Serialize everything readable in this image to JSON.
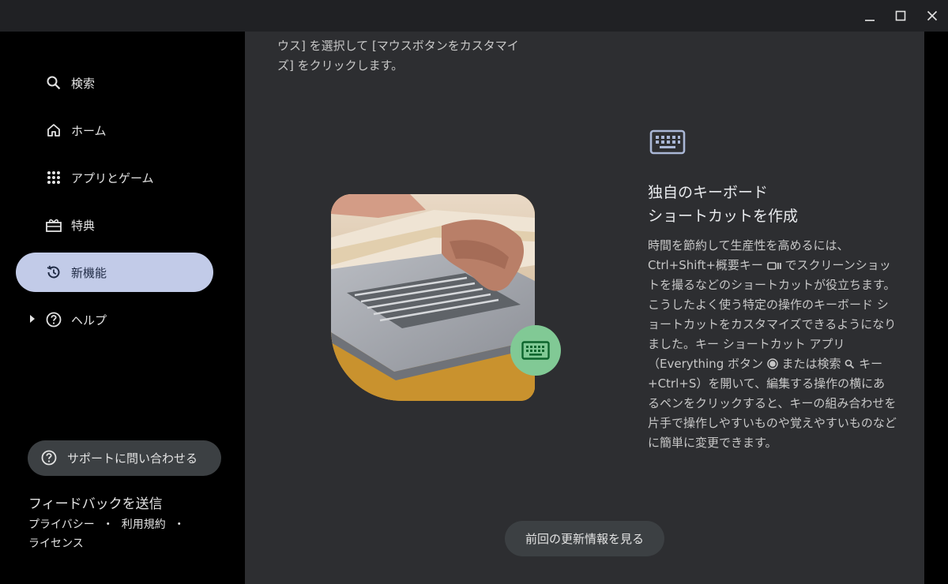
{
  "window": {
    "controls": {
      "minimize": "minimize-icon",
      "maximize": "maximize-icon",
      "close": "close-icon"
    }
  },
  "sidebar": {
    "items": [
      {
        "label": "検索",
        "icon": "search-icon"
      },
      {
        "label": "ホーム",
        "icon": "home-icon"
      },
      {
        "label": "アプリとゲーム",
        "icon": "apps-grid-icon"
      },
      {
        "label": "特典",
        "icon": "gift-icon"
      },
      {
        "label": "新機能",
        "icon": "history-icon",
        "active": true
      },
      {
        "label": "ヘルプ",
        "icon": "help-icon",
        "expandable": true
      }
    ],
    "support_label": "サポートに問い合わせる",
    "feedback_label": "フィードバックを送信",
    "legal": {
      "privacy": "プライバシー",
      "terms": "利用規約",
      "separator": "・",
      "license": "ライセンス"
    }
  },
  "main": {
    "top_text": "ウス] を選択して [マウスボタンをカスタマイズ] をクリックします。",
    "feature": {
      "icon": "keyboard-icon",
      "title_line1": "独自のキーボード",
      "title_line2": "ショートカットを作成",
      "body_part1": "時間を節約して生産性を高めるには、Ctrl+Shift+概要キー",
      "body_part2": "でスクリーンショットを撮るなどのショートカットが役立ちます。こうしたよく使う特定の操作のキーボード ショートカットをカスタマイズできるようになりました。キー ショートカット アプリ（Everything ボタン",
      "body_part3": "または検索",
      "body_part4": "キー+Ctrl+S）を開いて、編集する操作の横にあるペンをクリックすると、キーの組み合わせを片手で操作しやすいものや覚えやすいものなどに簡単に変更できます。"
    },
    "prev_button": "前回の更新情報を見る"
  },
  "colors": {
    "active_nav": "#c2cbe8",
    "badge": "#81c995",
    "main_bg": "#2d2e31"
  }
}
